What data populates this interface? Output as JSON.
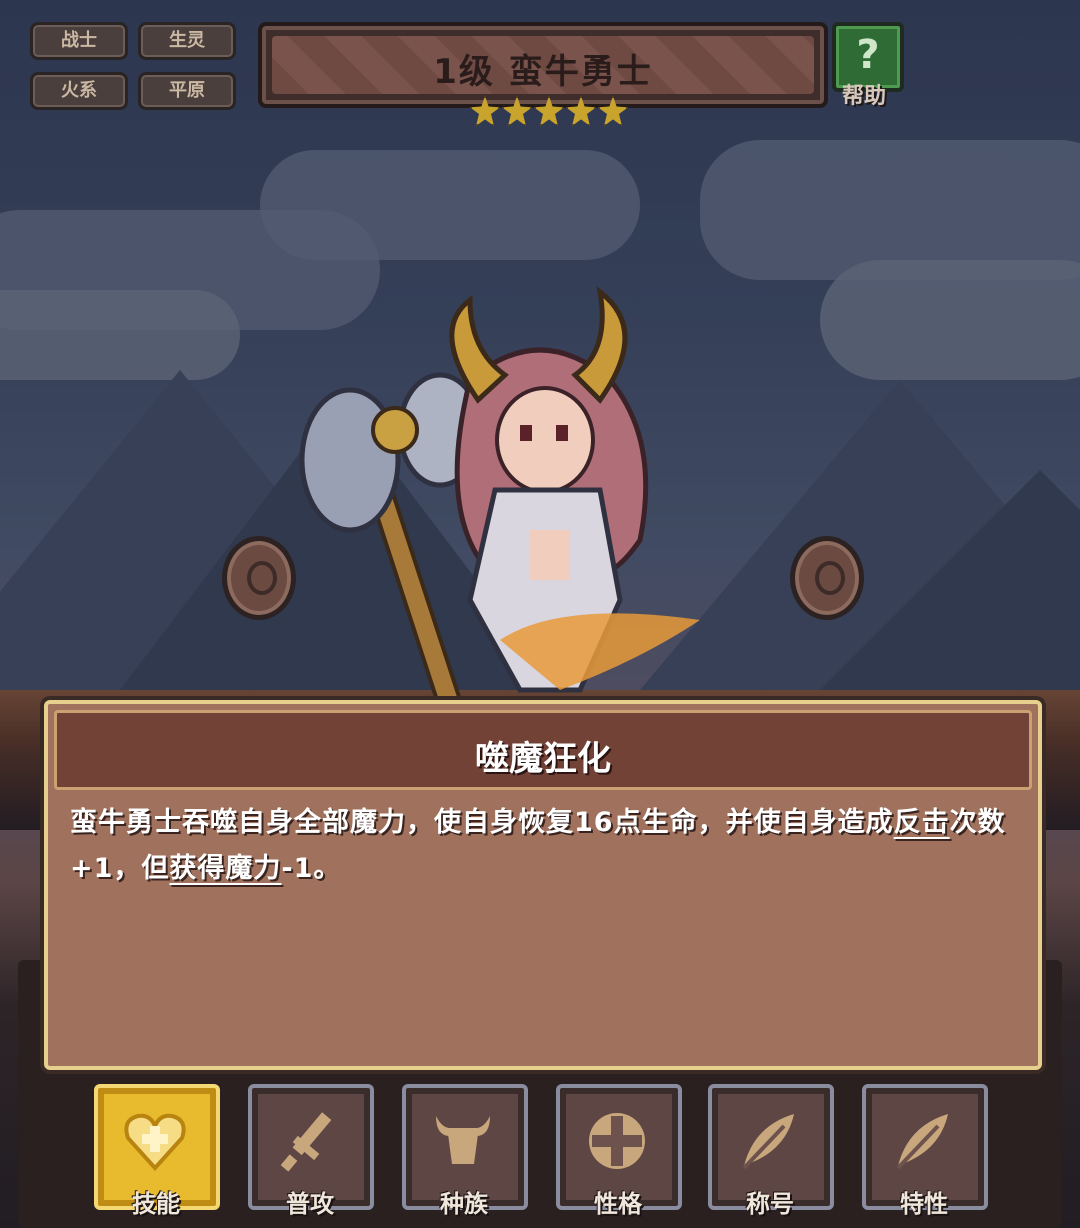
{
  "tags": [
    "战士",
    "生灵",
    "火系",
    "平原"
  ],
  "header": {
    "title": "1级  蛮牛勇士",
    "stars": 5,
    "help_label": "帮助",
    "help_glyph": "?"
  },
  "skill": {
    "name": "噬魔狂化",
    "desc_part1": "蛮牛勇士吞噬自身全部魔力，使自身恢复16点生命，并使自身造成",
    "keyword1": "反击",
    "desc_part2": "次数+1，但",
    "keyword2": "获得魔力",
    "desc_part3": "-1。"
  },
  "tabs": [
    {
      "label": "技能",
      "icon": "heart-shield-icon",
      "active": true
    },
    {
      "label": "普攻",
      "icon": "sword-icon",
      "active": false
    },
    {
      "label": "种族",
      "icon": "bull-head-icon",
      "active": false
    },
    {
      "label": "性格",
      "icon": "cross-icon",
      "active": false
    },
    {
      "label": "称号",
      "icon": "feather-icon",
      "active": false
    },
    {
      "label": "特性",
      "icon": "feather-icon",
      "active": false
    }
  ],
  "colors": {
    "active_tab": "#e8bb2e",
    "dialog_bg": "#a0725d",
    "dialog_border": "#e7cf8d",
    "star": "#c9a42c"
  }
}
